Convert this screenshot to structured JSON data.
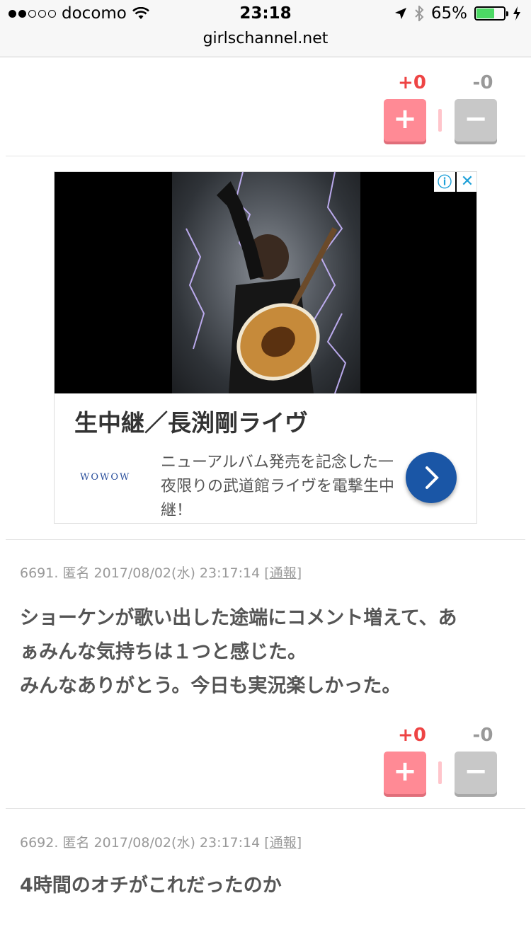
{
  "status_bar": {
    "carrier": "docomo",
    "signal_filled": 2,
    "signal_total": 5,
    "time": "23:18",
    "battery_percent": "65%",
    "battery_level": 0.65,
    "url": "girlschannel.net"
  },
  "top_vote": {
    "plus_count": "+0",
    "minus_count": "-0",
    "plus_label": "+",
    "minus_label": "−"
  },
  "ad": {
    "title": "生中継／長渕剛ライヴ",
    "logo": "WOWOW",
    "description": "ニューアルバム発売を記念した一夜限りの武道館ライヴを電撃生中継！",
    "info_icon": "info-icon",
    "close_icon": "close-icon",
    "cta_icon": "chevron-right-icon"
  },
  "comments": [
    {
      "number": "6691.",
      "author": "匿名",
      "datetime": "2017/08/02(水) 23:17:14",
      "report_open": "[",
      "report_label": "通報",
      "report_close": "]",
      "lines": [
        "ショーケンが歌い出した途端にコメント増えて、あ",
        "ぁみんな気持ちは１つと感じた。",
        "みんなありがとう。今日も実況楽しかった。"
      ],
      "plus_count": "+0",
      "minus_count": "-0"
    },
    {
      "number": "6692.",
      "author": "匿名",
      "datetime": "2017/08/02(水) 23:17:14",
      "report_open": "[",
      "report_label": "通報",
      "report_close": "]",
      "lines": [
        "4時間のオチがこれだったのか"
      ]
    }
  ],
  "colors": {
    "plus": "#ff8a95",
    "minus": "#c8c8c8",
    "plus_text": "#ee4444",
    "ad_cta": "#1a56a6",
    "battery": "#4cd964"
  }
}
